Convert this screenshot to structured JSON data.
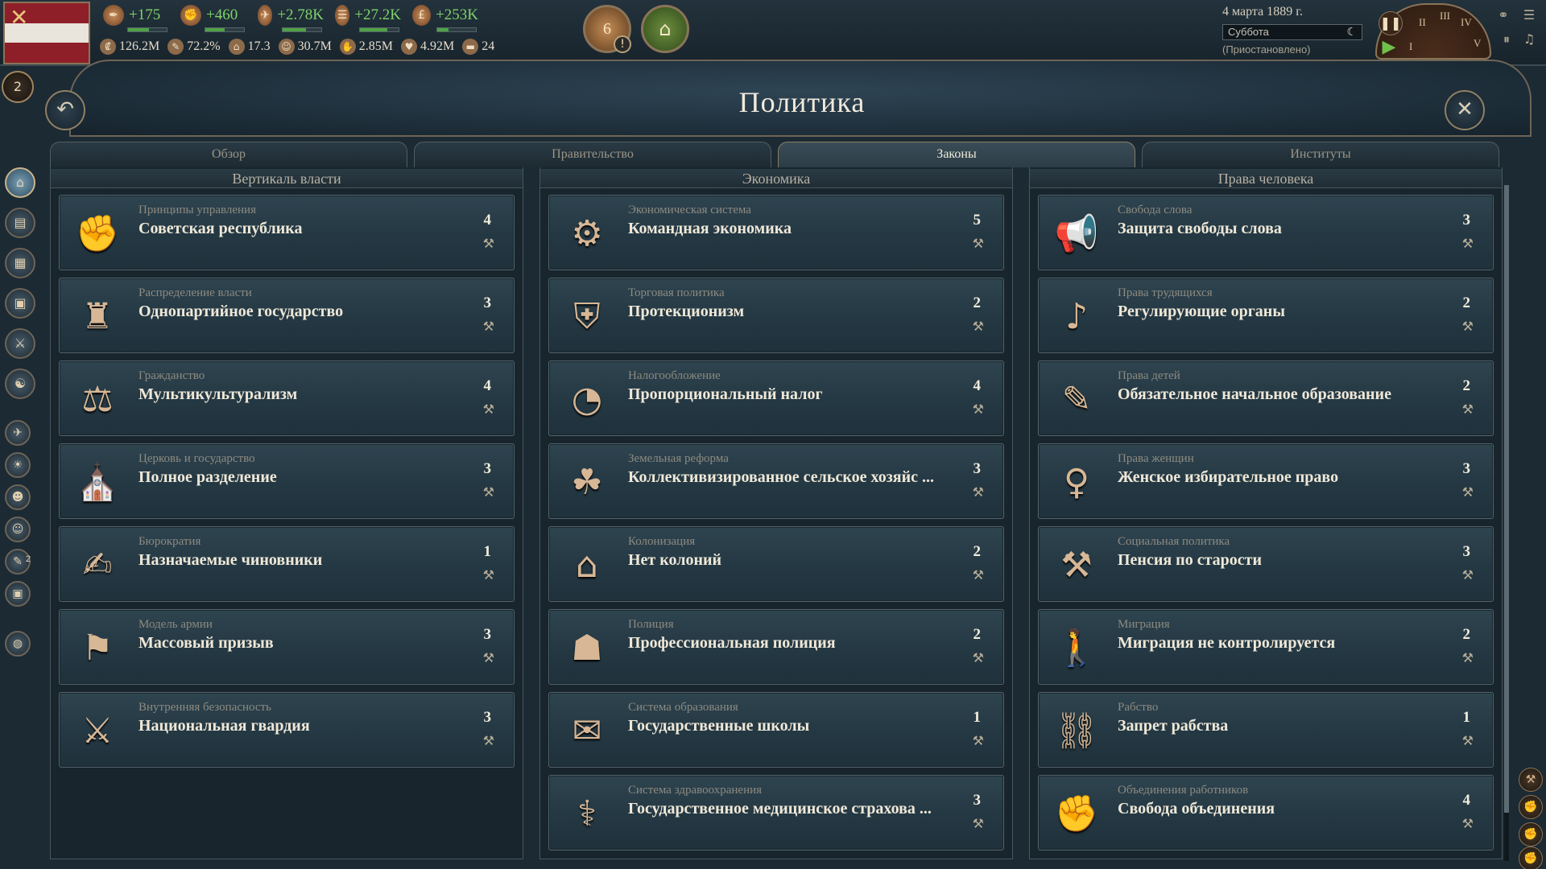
{
  "topbar": {
    "stats_row1": [
      {
        "icon": "bureaucracy-icon",
        "glyph": "✒",
        "value": "+175",
        "bar": 0.55
      },
      {
        "icon": "authority-icon",
        "glyph": "✊",
        "value": "+460",
        "bar": 0.5
      },
      {
        "icon": "influence-icon",
        "glyph": "✈",
        "value": "+2.78K",
        "bar": 0.6
      },
      {
        "icon": "budget-icon",
        "glyph": "☰",
        "value": "+27.2K",
        "bar": 0.7
      },
      {
        "icon": "money-icon",
        "glyph": "£",
        "value": "+253K",
        "bar": 0.3
      }
    ],
    "stats_row2": [
      {
        "icon": "gdp-icon",
        "glyph": "₡",
        "value": "126.2M"
      },
      {
        "icon": "literacy-icon",
        "glyph": "✎",
        "value": "72.2%"
      },
      {
        "icon": "sol-icon",
        "glyph": "⌂",
        "value": "17.3"
      },
      {
        "icon": "population-icon",
        "glyph": "☺",
        "value": "30.7M"
      },
      {
        "icon": "workforce-icon",
        "glyph": "✋",
        "value": "2.85M"
      },
      {
        "icon": "radicals-icon",
        "glyph": "♥",
        "value": "4.92M"
      },
      {
        "icon": "army-icon",
        "glyph": "▬",
        "value": "24"
      }
    ],
    "journal_count": "6",
    "journal_alert": "!",
    "date": "4 марта 1889 г.",
    "weekday": "Суббота",
    "status": "(Приостановлено)",
    "speed_labels": [
      "II",
      "III",
      "IV",
      "V",
      "I"
    ],
    "notification_count": "2"
  },
  "header": {
    "title": "Политика",
    "back_glyph": "↶",
    "close_glyph": "✕"
  },
  "tabs": [
    "Обзор",
    "Правительство",
    "Законы",
    "Институты"
  ],
  "active_tab": "Законы",
  "columns": [
    {
      "title": "Вертикаль власти",
      "laws": [
        {
          "category": "Принципы управления",
          "name": "Советская республика",
          "num": "4",
          "glyph": "✊"
        },
        {
          "category": "Распределение власти",
          "name": "Однопартийное государство",
          "num": "3",
          "glyph": "♜"
        },
        {
          "category": "Гражданство",
          "name": "Мультикультурализм",
          "num": "4",
          "glyph": "⚖"
        },
        {
          "category": "Церковь и государство",
          "name": "Полное разделение",
          "num": "3",
          "glyph": "⛪"
        },
        {
          "category": "Бюрократия",
          "name": "Назначаемые чиновники",
          "num": "1",
          "glyph": "✍"
        },
        {
          "category": "Модель армии",
          "name": "Массовый призыв",
          "num": "3",
          "glyph": "⚑"
        },
        {
          "category": "Внутренняя безопасность",
          "name": "Национальная гвардия",
          "num": "3",
          "glyph": "⚔"
        }
      ]
    },
    {
      "title": "Экономика",
      "laws": [
        {
          "category": "Экономическая система",
          "name": "Командная экономика",
          "num": "5",
          "glyph": "⚙"
        },
        {
          "category": "Торговая политика",
          "name": "Протекционизм",
          "num": "2",
          "glyph": "⛨"
        },
        {
          "category": "Налогообложение",
          "name": "Пропорциональный налог",
          "num": "4",
          "glyph": "◔"
        },
        {
          "category": "Земельная реформа",
          "name": "Коллективизированное сельское хозяйс ...",
          "num": "3",
          "glyph": "☘"
        },
        {
          "category": "Колонизация",
          "name": "Нет колоний",
          "num": "2",
          "glyph": "⌂"
        },
        {
          "category": "Полиция",
          "name": "Профессиональная полиция",
          "num": "2",
          "glyph": "☗"
        },
        {
          "category": "Система образования",
          "name": "Государственные школы",
          "num": "1",
          "glyph": "✉"
        },
        {
          "category": "Система здравоохранения",
          "name": "Государственное медицинское страхова ...",
          "num": "3",
          "glyph": "⚕"
        }
      ]
    },
    {
      "title": "Права человека",
      "laws": [
        {
          "category": "Свобода слова",
          "name": "Защита свободы слова",
          "num": "3",
          "glyph": "📢"
        },
        {
          "category": "Права трудящихся",
          "name": "Регулирующие органы",
          "num": "2",
          "glyph": "♪"
        },
        {
          "category": "Права детей",
          "name": "Обязательное начальное образование",
          "num": "2",
          "glyph": "✎"
        },
        {
          "category": "Права женщин",
          "name": "Женское избирательное право",
          "num": "3",
          "glyph": "♀"
        },
        {
          "category": "Социальная политика",
          "name": "Пенсия по старости",
          "num": "3",
          "glyph": "⚒"
        },
        {
          "category": "Миграция",
          "name": "Миграция не контролируется",
          "num": "2",
          "glyph": "🚶"
        },
        {
          "category": "Рабство",
          "name": "Запрет рабства",
          "num": "1",
          "glyph": "⛓"
        },
        {
          "category": "Объединения работников",
          "name": "Свобода объединения",
          "num": "4",
          "glyph": "✊"
        }
      ]
    }
  ],
  "stance_glyph": "⚒",
  "colors": {
    "positive": "#7fd36b",
    "panel": "#243843",
    "accent_gold": "#8a7458"
  }
}
